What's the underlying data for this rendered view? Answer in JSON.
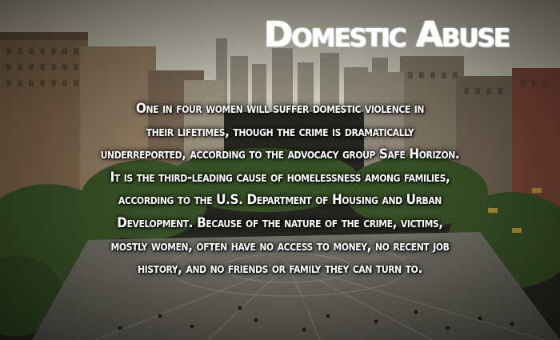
{
  "title": "Domestic Abuse",
  "body_lines": [
    "One in four women will suffer domestic violence in",
    "their lifetimes, though the crime is dramatically",
    "underreported, according to the advocacy group Safe Horizon.",
    "It is the third-leading cause of homelessness among families,",
    "according to the U.S. Department of Housing and Urban",
    "Development. Because of the nature of the crime, victims,",
    "mostly women, often have no access to money, no recent job",
    "history, and no friends or family they can turn to."
  ],
  "colors": {
    "text": "#ffffff",
    "sky": "#cfcfbf",
    "buildings": "#7a6a58",
    "foliage": "#3f5a2c",
    "plaza": "#8a8a80"
  }
}
